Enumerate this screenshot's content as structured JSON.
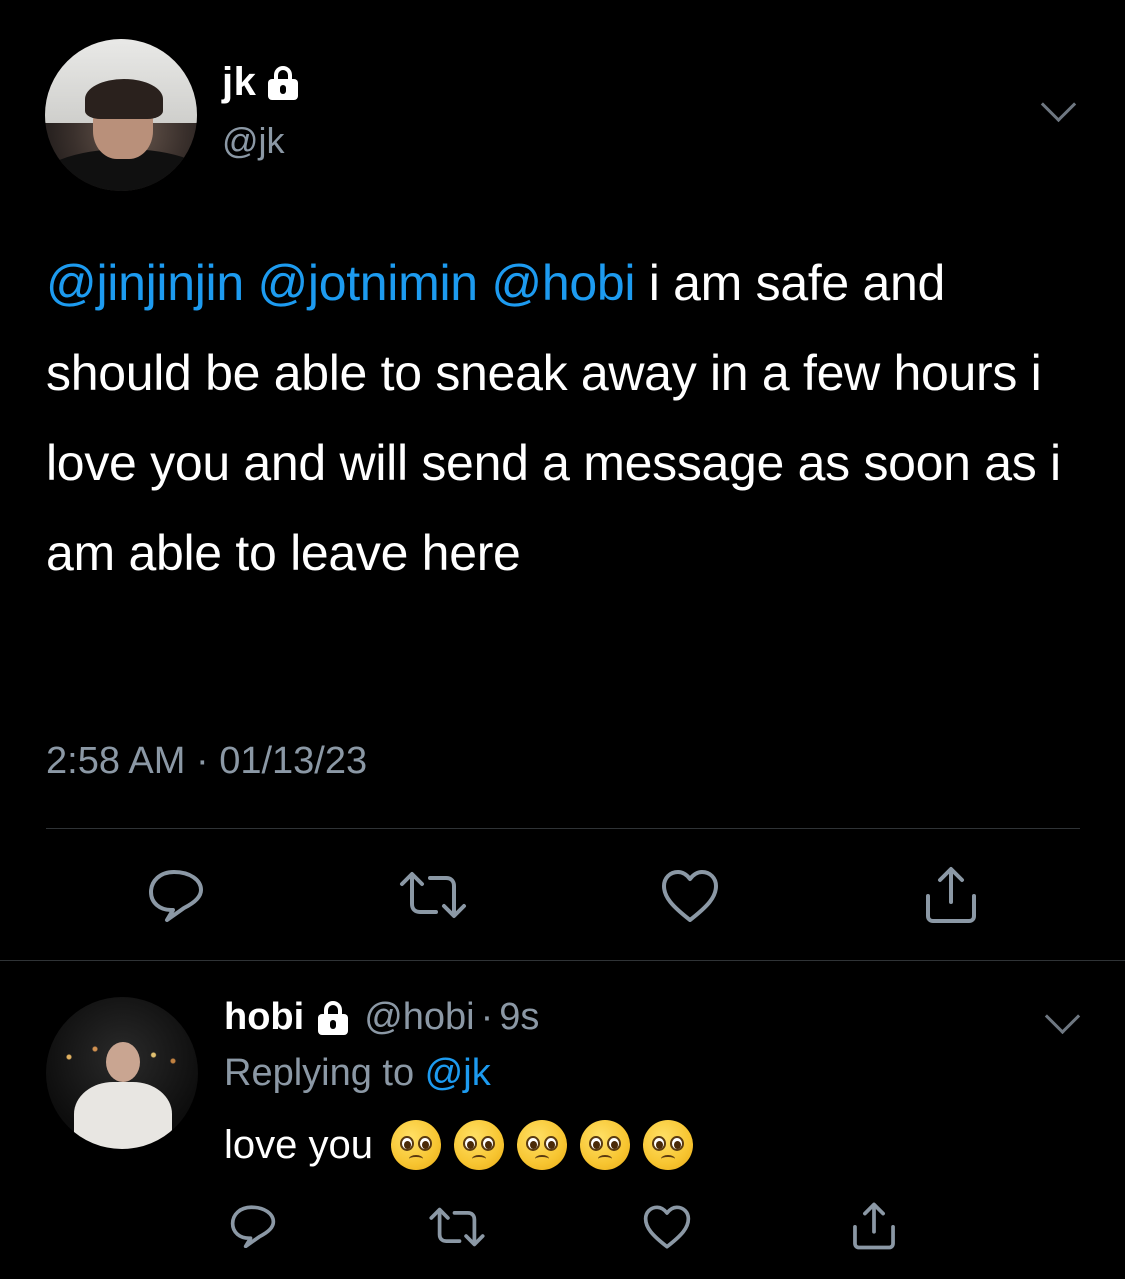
{
  "tweet": {
    "author_name": "jk",
    "author_handle": "@jk",
    "mentions": [
      "@jinjinjin",
      "@jotnimin",
      "@hobi"
    ],
    "text": " i am safe and should be able to sneak away in a few hours i love you and will send a message as soon as i am able to leave here",
    "time": "2:58 AM",
    "separator": " · ",
    "date": "01/13/23"
  },
  "reply": {
    "author_name": "hobi",
    "author_handle": "@hobi",
    "dot": "·",
    "time": "9s",
    "replying_prefix": "Replying to ",
    "replying_to": "@jk",
    "text": "love you",
    "emoji_count": 5
  },
  "icons": {
    "lock": "lock-icon",
    "chevron": "chevron-down-icon",
    "reply": "reply-icon",
    "retweet": "retweet-icon",
    "like": "heart-icon",
    "share": "share-icon",
    "emoji": "pleading-face-icon"
  },
  "colors": {
    "background": "#000000",
    "text": "#ffffff",
    "muted": "#8b98a5",
    "mention": "#1d9bf0",
    "divider": "#2f3336"
  }
}
